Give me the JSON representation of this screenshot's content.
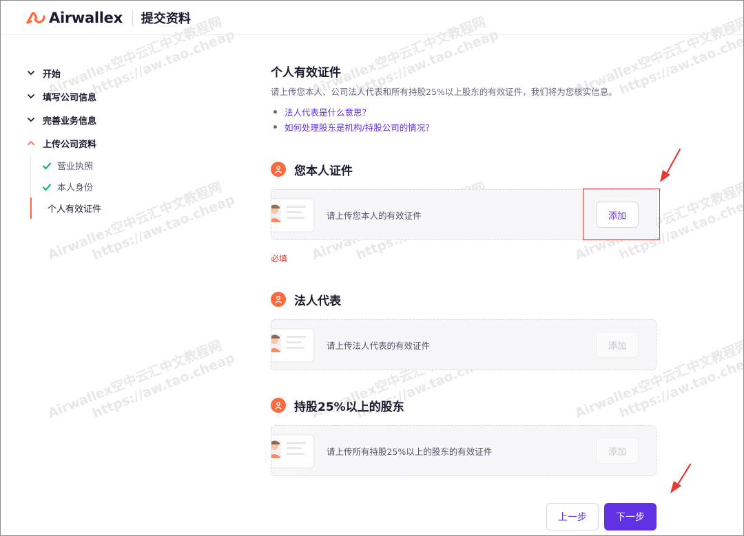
{
  "header": {
    "brand": "Airwallex",
    "title": "提交资料",
    "brand_color": "#ff6a3d"
  },
  "sidebar": {
    "steps": [
      {
        "label": "开始",
        "state": "collapsed"
      },
      {
        "label": "填写公司信息",
        "state": "collapsed"
      },
      {
        "label": "完善业务信息",
        "state": "collapsed"
      },
      {
        "label": "上传公司资料",
        "state": "expanded"
      }
    ],
    "substeps": [
      {
        "label": "营业执照",
        "state": "done"
      },
      {
        "label": "本人身份",
        "state": "done"
      },
      {
        "label": "个人有效证件",
        "state": "current"
      }
    ]
  },
  "main": {
    "title": "个人有效证件",
    "description": "请上传您本人、公司法人代表和所有持股25%以上股东的有效证件，我们将为您核实信息。",
    "links": [
      "法人代表是什么意思？",
      "如何处理股东是机构/持股公司的情况？"
    ],
    "sections": [
      {
        "title": "您本人证件",
        "upload_text": "请上传您本人的有效证件",
        "add_label": "添加",
        "enabled": true,
        "required_text": "必填"
      },
      {
        "title": "法人代表",
        "upload_text": "请上传法人代表的有效证件",
        "add_label": "添加",
        "enabled": false
      },
      {
        "title": "持股25%以上的股东",
        "upload_text": "请上传所有持股25%以上的股东的有效证件",
        "add_label": "添加",
        "enabled": false
      }
    ]
  },
  "footer": {
    "prev_label": "上一步",
    "next_label": "下一步"
  },
  "colors": {
    "accent": "#6132e4",
    "orange": "#ff6a3d",
    "success": "#12b76a",
    "error": "#d9362b",
    "annotation": "#e53935"
  },
  "watermark": {
    "line1": "Airwallex空中云汇中文教程网",
    "line2": "https://aw.tao.cheap"
  }
}
